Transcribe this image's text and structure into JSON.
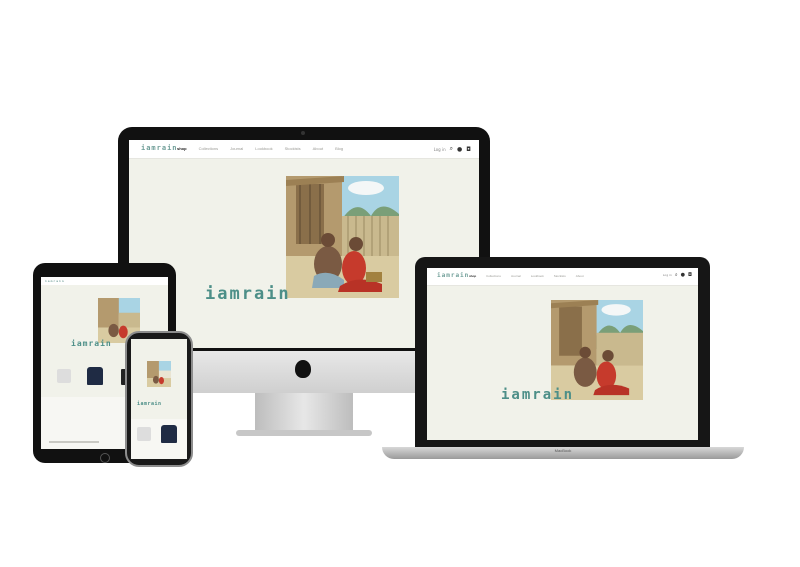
{
  "site": {
    "logo": "iamrain",
    "brand_text": "iamrain",
    "menu": [
      "shop",
      "Collections",
      "Journal",
      "Lookbook",
      "Stockists",
      "About",
      "Blog"
    ],
    "active_menu_index": 0,
    "account_text": "Log in",
    "icons": [
      "search-icon",
      "account-icon",
      "cart-icon"
    ]
  },
  "laptop": {
    "base_label": "MacBook"
  },
  "colors": {
    "screen_bg": "#f1f2ea",
    "brand_teal": "#4d8f88",
    "logo_teal": "#6f9e98"
  }
}
